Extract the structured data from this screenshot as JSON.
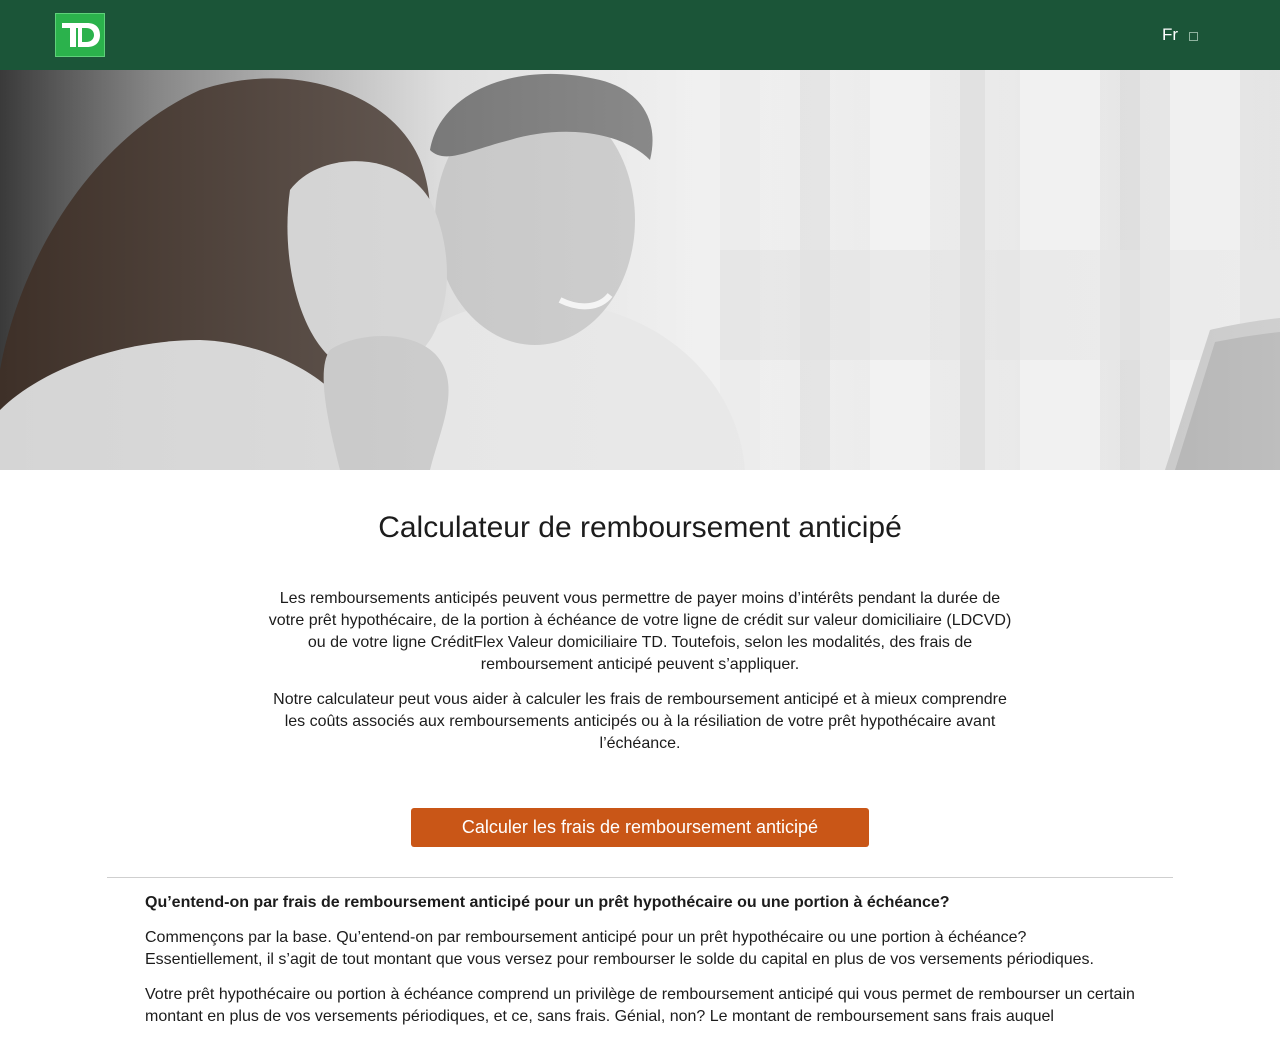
{
  "header": {
    "logo_text": "TD",
    "lang_label": "Fr",
    "brand_color": "#1b5538",
    "logo_color": "#2bb24c"
  },
  "hero": {
    "image": "photo-couple-laptop"
  },
  "main": {
    "title": "Calculateur de remboursement anticipé",
    "intro_p1": "Les remboursements anticipés peuvent vous permettre de payer moins d’intérêts pendant la durée de votre prêt hypothécaire, de la portion à échéance de votre ligne de crédit sur valeur domiciliaire (LDCVD) ou de votre ligne CréditFlex Valeur domiciliaire TD. Toutefois, selon les modalités, des frais de remboursement anticipé peuvent s’appliquer.",
    "intro_p2": "Notre calculateur peut vous aider à calculer les frais de remboursement anticipé et à mieux comprendre les coûts associés aux remboursements anticipés ou à la résiliation de votre prêt hypothécaire avant l’échéance.",
    "cta_label": "Calculer les frais de remboursement anticipé",
    "cta_color": "#c95617"
  },
  "faq": {
    "heading": "Qu’entend-on par frais de remboursement anticipé pour un prêt hypothécaire ou une portion à échéance?",
    "p1": "Commençons par la base. Qu’entend-on par remboursement anticipé pour un prêt hypothécaire ou une portion à échéance? Essentiellement, il s’agit de tout montant que vous versez pour rembourser le solde du capital en plus de vos versements périodiques.",
    "p2": "Votre prêt hypothécaire ou portion à échéance comprend un privilège de remboursement anticipé qui vous permet de rembourser un certain montant en plus de vos versements périodiques, et ce, sans frais. Génial, non? Le montant de remboursement sans frais auquel"
  }
}
